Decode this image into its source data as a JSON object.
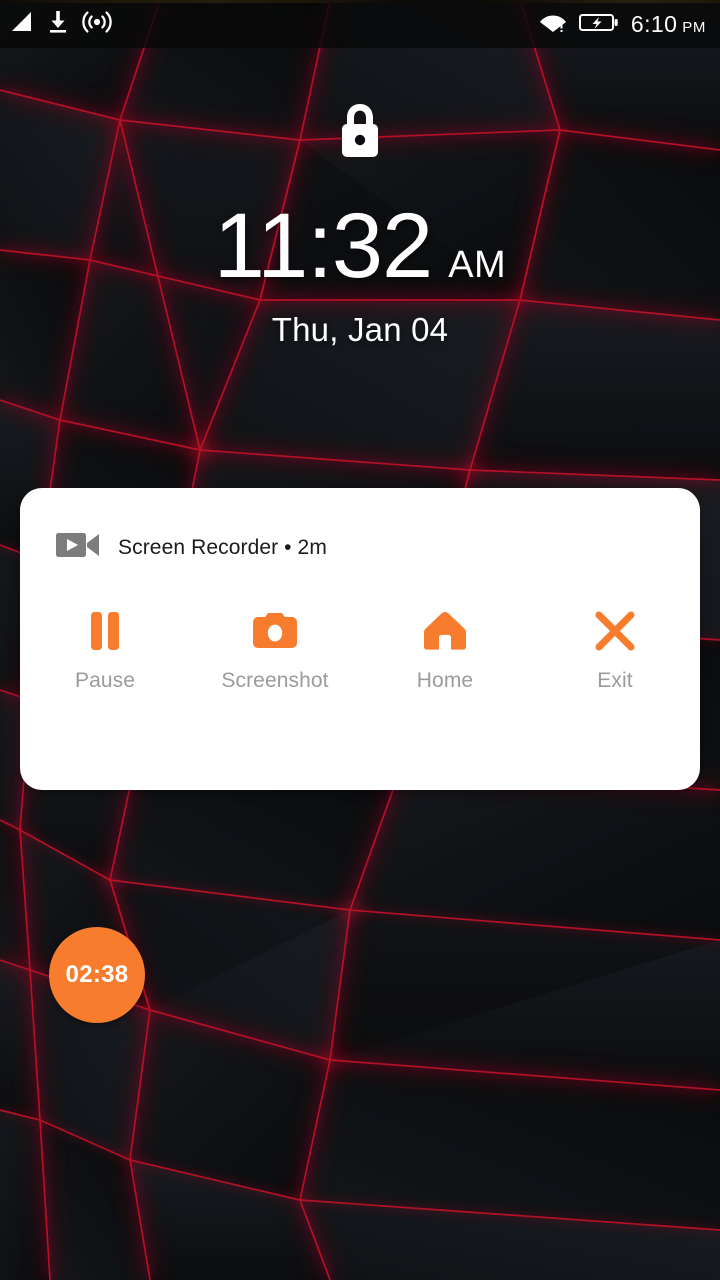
{
  "theme": {
    "accent": "#f87c2d",
    "card_bg": "#ffffff",
    "label_grey": "#9b9b9b",
    "wallpaper_base": "#0e1013",
    "wallpaper_seam": "#c0142a"
  },
  "status_bar": {
    "left_icons": [
      "signal-icon",
      "download-icon",
      "hotspot-icon"
    ],
    "right_icons": [
      "wifi-icon",
      "battery-charging-icon"
    ],
    "time": "6:10",
    "ampm": "PM"
  },
  "lock_screen": {
    "lock_icon": "lock-icon",
    "time": "11:32",
    "ampm": "AM",
    "date": "Thu, Jan 04"
  },
  "notification": {
    "app_icon": "video-camera-icon",
    "title": "Screen Recorder • 2m",
    "actions": [
      {
        "icon": "pause-icon",
        "label": "Pause"
      },
      {
        "icon": "camera-icon",
        "label": "Screenshot"
      },
      {
        "icon": "home-icon",
        "label": "Home"
      },
      {
        "icon": "close-x-icon",
        "label": "Exit"
      }
    ]
  },
  "timer_bubble": {
    "elapsed": "02:38"
  }
}
